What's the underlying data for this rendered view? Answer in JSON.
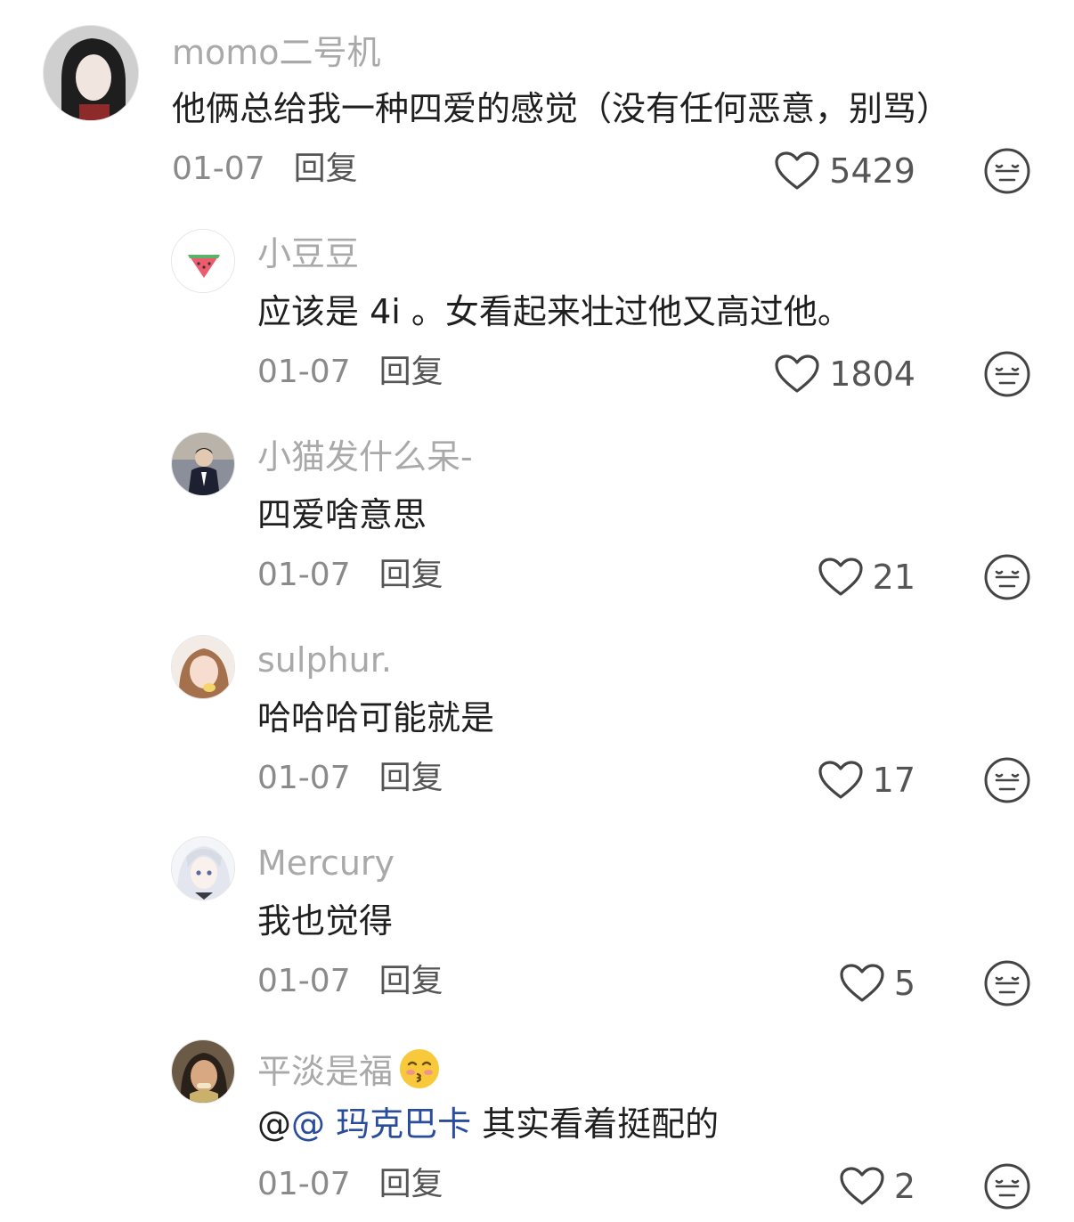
{
  "comments": [
    {
      "username": "momo二号机",
      "text": "他俩总给我一种四爱的感觉（没有任何恶意，别骂）",
      "date": "01-07",
      "reply_label": "回复",
      "likes": "5429"
    },
    {
      "username": "小豆豆",
      "text": "应该是 4i 。女看起来壮过他又高过他。",
      "date": "01-07",
      "reply_label": "回复",
      "likes": "1804"
    },
    {
      "username": "小猫发什么呆-",
      "text": "四爱啥意思",
      "date": "01-07",
      "reply_label": "回复",
      "likes": "21"
    },
    {
      "username": "sulphur.",
      "text": "哈哈哈可能就是",
      "date": "01-07",
      "reply_label": "回复",
      "likes": "17"
    },
    {
      "username": "Mercury",
      "text": "我也觉得",
      "date": "01-07",
      "reply_label": "回复",
      "likes": "5"
    },
    {
      "username": "平淡是福",
      "username_emoji": "kissing-face-closed-eyes",
      "text_prefix": "@",
      "mention": "@ 玛克巴卡",
      "text": " 其实看着挺配的",
      "date": "01-07",
      "reply_label": "回复",
      "likes": "2"
    }
  ],
  "icons": {
    "like": "heart-outline-icon",
    "dislike": "neutral-face-icon"
  },
  "colors": {
    "username": "#a9a9a9",
    "text": "#1f1f1f",
    "meta": "#8a8a8a",
    "mention": "#2a4c9c"
  }
}
